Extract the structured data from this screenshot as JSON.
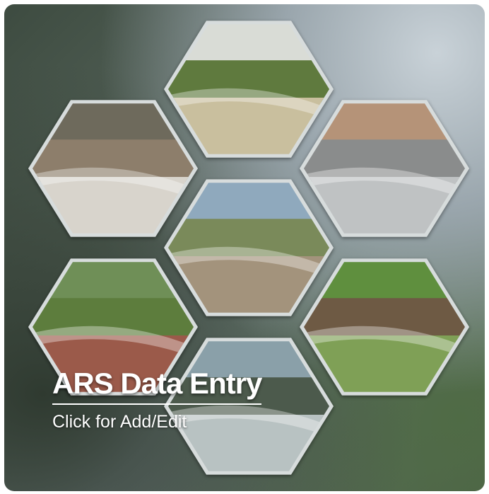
{
  "tile": {
    "title": "ARS Data Entry",
    "subtitle": "Click for Add/Edit"
  },
  "photos": [
    {
      "name": "photo-pond-landscape",
      "sky": "#d9dcd6",
      "land": "#5f7a3e",
      "water": "#c9bf9e"
    },
    {
      "name": "photo-canal-overflow",
      "sky": "#6e6a5c",
      "land": "#8d7e6b",
      "water": "#d8d4cc"
    },
    {
      "name": "photo-lined-pond",
      "sky": "#b59378",
      "land": "#8a8c8c",
      "water": "#bfc2c3"
    },
    {
      "name": "photo-check-dam-overflow",
      "sky": "#8fa9bd",
      "land": "#7a8a5a",
      "water": "#a3937c"
    },
    {
      "name": "photo-shed-pipe",
      "sky": "#6f8f57",
      "land": "#5d7d3d",
      "water": "#9b5a4a"
    },
    {
      "name": "photo-field-workers",
      "sky": "#5f8f3e",
      "land": "#6e5a44",
      "water": "#7fa056"
    },
    {
      "name": "photo-channel-bottom",
      "sky": "#8aa0a9",
      "land": "#4c5a4c",
      "water": "#b8c2c2"
    }
  ]
}
